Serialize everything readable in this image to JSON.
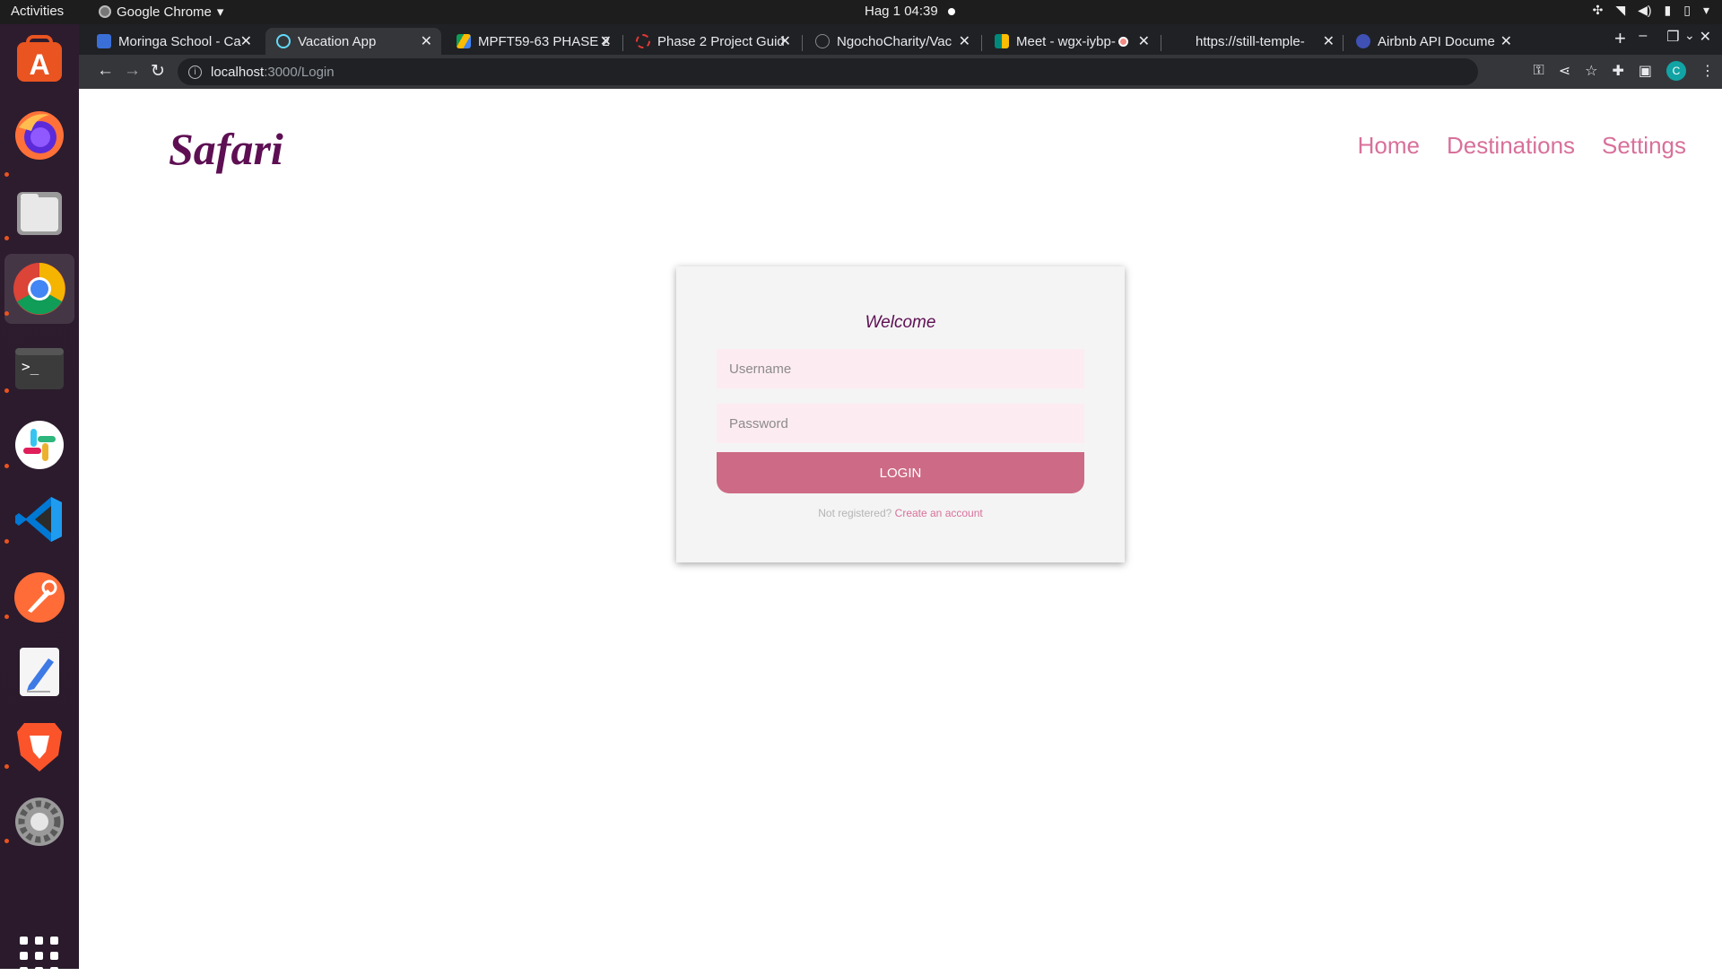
{
  "os": {
    "activities": "Activities",
    "app_name": "Google Chrome",
    "clock": "Hag 1  04:39"
  },
  "tabs": [
    {
      "title": "Moringa School - Ca",
      "color": "#3b6fd8"
    },
    {
      "title": "Vacation App",
      "color": "#61dafb",
      "active": true
    },
    {
      "title": "MPFT59-63 PHASE 2",
      "color": "#fbbc04"
    },
    {
      "title": "Phase 2 Project Guid",
      "color": "#e53935"
    },
    {
      "title": "NgochoCharity/Vac",
      "color": "#888888"
    },
    {
      "title": "Meet - wgx-iybp-",
      "color": "#00897b"
    },
    {
      "title": "https://still-temple-",
      "color": "#202124"
    },
    {
      "title": "Airbnb API Docume",
      "color": "#3f51b5"
    }
  ],
  "address": {
    "host": "localhost",
    "path": ":3000/Login"
  },
  "profile_initial": "C",
  "page": {
    "brand": "Safari",
    "nav": {
      "home": "Home",
      "destinations": "Destinations",
      "settings": "Settings"
    },
    "login": {
      "heading": "Welcome",
      "username_placeholder": "Username",
      "password_placeholder": "Password",
      "button": "LOGIN",
      "register_prompt": "Not registered?",
      "register_link": "Create an account"
    }
  },
  "colors": {
    "brand": "#5e0f53",
    "accent": "#cd6a85",
    "nav_link": "#d8709a",
    "field_bg": "#fdebf2"
  }
}
